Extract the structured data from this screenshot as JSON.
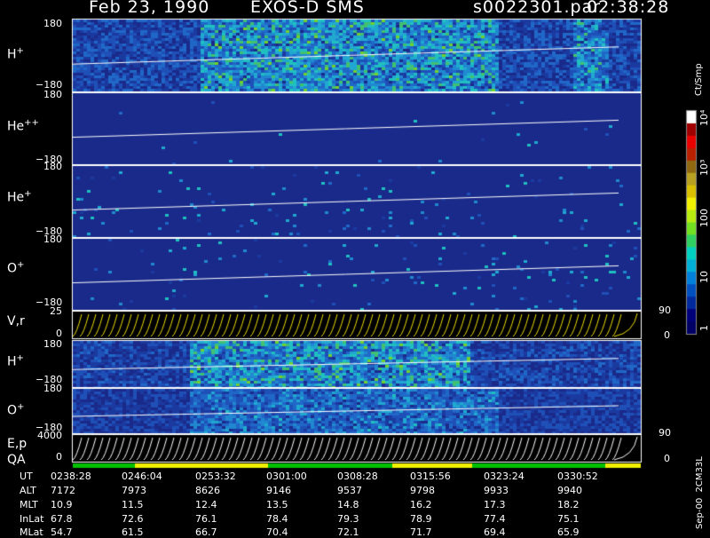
{
  "header": {
    "title": "Feb 23, 1990",
    "instrument": "EXOS-D SMS",
    "file": "s0022301.par",
    "time": "02:38:28"
  },
  "panels": [
    {
      "label": "H",
      "sup": "+",
      "ytop": "180",
      "ybot": "−180"
    },
    {
      "label": "He",
      "sup": "++",
      "ytop": "180",
      "ybot": "−180"
    },
    {
      "label": "He",
      "sup": "+",
      "ytop": "180",
      "ybot": "−180"
    },
    {
      "label": "O",
      "sup": "+",
      "ytop": "180",
      "ybot": "−180"
    },
    {
      "label": "V,r",
      "sup": "",
      "ytop": "25",
      "ybot": "0",
      "rtop": "90",
      "rbot": "0"
    },
    {
      "label": "H",
      "sup": "+",
      "ytop": "180",
      "ybot": "−180"
    },
    {
      "label": "O",
      "sup": "+",
      "ytop": "180",
      "ybot": "−180"
    },
    {
      "label": "E,p",
      "sup": "",
      "ytop": "4000",
      "ybot": "0",
      "rtop": "90",
      "rbot": "0"
    }
  ],
  "qa_label": "QA",
  "colorbar": {
    "unit": "Ct/Smp",
    "ticks": [
      "1",
      "10",
      "100",
      "10³",
      "10⁴"
    ],
    "colors": [
      "#000066",
      "#00007a",
      "#002a9e",
      "#0050c0",
      "#0080d8",
      "#00b0d8",
      "#00d0c0",
      "#30d060",
      "#70e020",
      "#b8ec10",
      "#f0f000",
      "#d8c000",
      "#b8a020",
      "#906810",
      "#b82000",
      "#e80000",
      "#a00000",
      "#ffffff"
    ]
  },
  "stats_table": {
    "rows": [
      {
        "name": "UT",
        "values": [
          "0238:28",
          "0246:04",
          "0253:32",
          "0301:00",
          "0308:28",
          "0315:56",
          "0323:24",
          "0330:52"
        ]
      },
      {
        "name": "ALT",
        "values": [
          "7172",
          "7973",
          "8626",
          "9146",
          "9537",
          "9798",
          "9933",
          "9940"
        ]
      },
      {
        "name": "MLT",
        "values": [
          "10.9",
          "11.5",
          "12.4",
          "13.5",
          "14.8",
          "16.2",
          "17.3",
          "18.2"
        ]
      },
      {
        "name": "InLat",
        "values": [
          "67.8",
          "72.6",
          "76.1",
          "78.4",
          "79.3",
          "78.9",
          "77.4",
          "75.1"
        ]
      },
      {
        "name": "MLat",
        "values": [
          "54.7",
          "61.5",
          "66.7",
          "70.4",
          "72.1",
          "71.7",
          "69.4",
          "65.9"
        ]
      }
    ]
  },
  "footer_note": "Sep-00  2CM33L"
}
